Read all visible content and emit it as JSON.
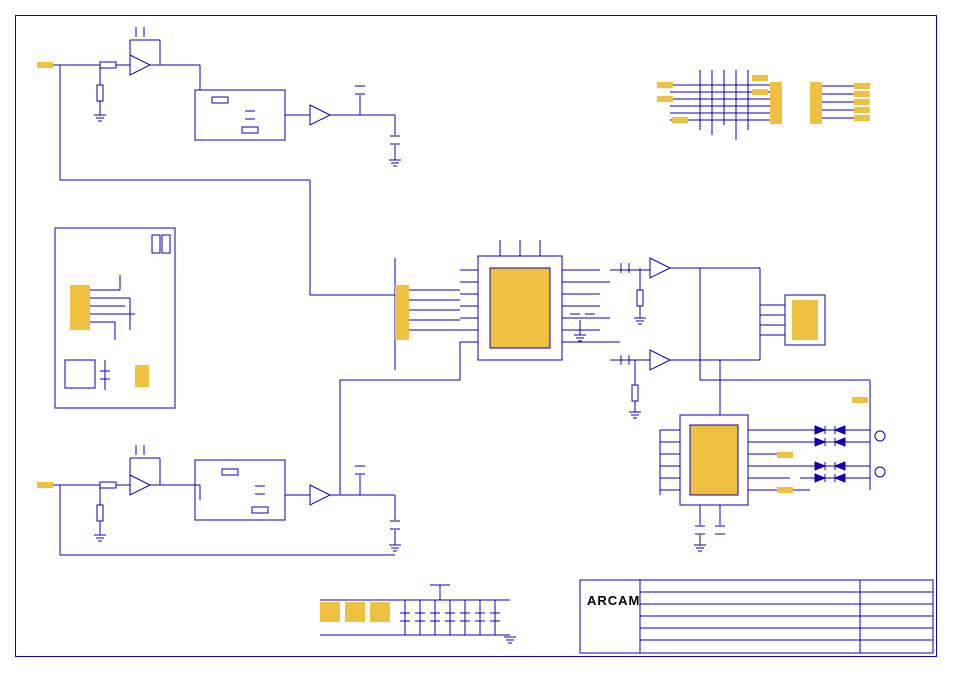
{
  "logo_text": "ARCAM",
  "title_block": {
    "rows": 6,
    "cols": 2
  },
  "schematic": {
    "description": "Electronic schematic diagram with op-amp circuits, IC blocks, connectors and passive components",
    "sections": [
      "upper-left-signal-chain",
      "lower-left-signal-chain",
      "center-ic-block",
      "right-ic-block",
      "connector-group-top-right",
      "connector-group-left-box",
      "power-rail-block"
    ],
    "colors": {
      "wire": "#1200a8",
      "pad": "#f0c040"
    }
  }
}
